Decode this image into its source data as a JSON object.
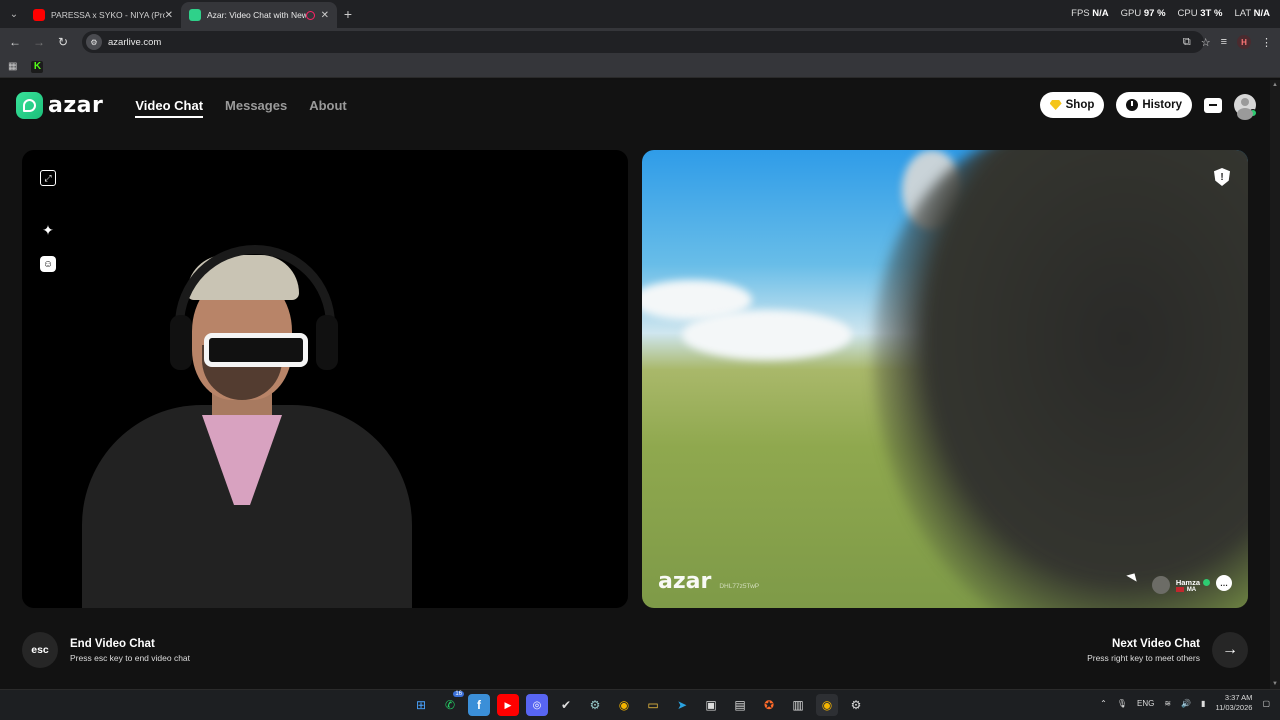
{
  "browser": {
    "tabs": [
      {
        "title": "PARESSA x SYKO - NIYA (Prod",
        "favicon_color": "#ff0000"
      },
      {
        "title": "Azar: Video Chat with New",
        "favicon_color": "#2fd18a"
      }
    ],
    "url": "azarlive.com",
    "overlay": {
      "fps_label": "FPS",
      "fps_value": "N/A",
      "gpu_label": "GPU",
      "gpu_value": "97 %",
      "cpu_label": "CPU",
      "cpu_value": "3T %",
      "lat_label": "LAT",
      "lat_value": "N/A"
    },
    "profile_initial": "H"
  },
  "site": {
    "brand": "azar",
    "nav": {
      "video_chat": "Video Chat",
      "messages": "Messages",
      "about": "About"
    },
    "shop_label": "Shop",
    "history_label": "History"
  },
  "remote": {
    "watermark": "azar",
    "code": "DHL77z5TwP",
    "peer_name": "Hamza",
    "peer_country": "MA"
  },
  "controls": {
    "esc_label": "esc",
    "end_title": "End Video Chat",
    "end_hint": "Press esc key to end video chat",
    "next_title": "Next Video Chat",
    "next_hint": "Press right key to meet others"
  },
  "taskbar": {
    "language": "ENG",
    "time": "3:37 AM",
    "date": "11/03/2026",
    "whatsapp_badge": "16"
  },
  "colors": {
    "accent": "#2fd18a",
    "online": "#2ecc71"
  }
}
